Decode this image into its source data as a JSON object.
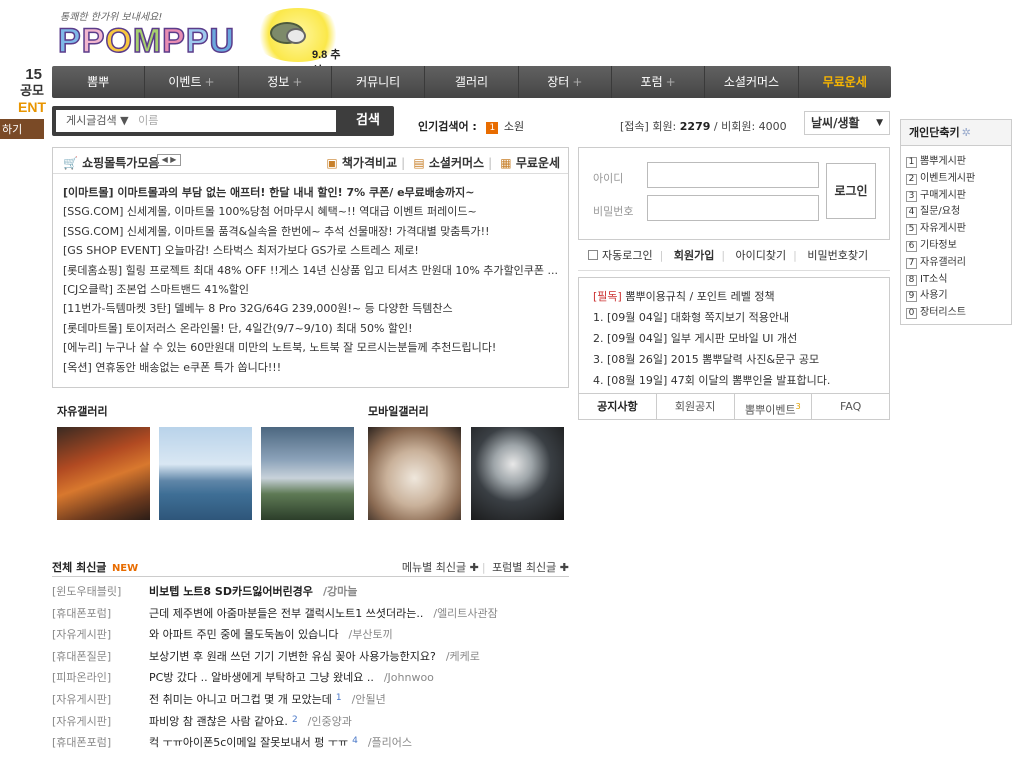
{
  "edge_banner": {
    "year": "15",
    "contest": "공모",
    "event": "ENT",
    "go": "하기"
  },
  "header": {
    "tagline": "통쾌한 한가위 보내세요!",
    "logo": [
      "P",
      "P",
      "O",
      "M",
      "P",
      "P",
      "U"
    ],
    "logo_colors": [
      "#7fb8e8",
      "#f2b7cf",
      "#f8c840",
      "#a7d06f",
      "#e88db3",
      "#9ec9ee",
      "#6aa7de"
    ],
    "holiday_date": "9.8 추석"
  },
  "gnb": {
    "items": [
      {
        "label": "뽐뿌",
        "plus": ""
      },
      {
        "label": "이벤트",
        "plus": "+"
      },
      {
        "label": "정보",
        "plus": "+"
      },
      {
        "label": "커뮤니티",
        "plus": ""
      },
      {
        "label": "갤러리",
        "plus": ""
      },
      {
        "label": "장터",
        "plus": "+"
      },
      {
        "label": "포럼",
        "plus": "+"
      },
      {
        "label": "소셜커머스",
        "plus": ""
      },
      {
        "label": "무료운세",
        "plus": "",
        "highlight": true
      }
    ]
  },
  "search": {
    "select_label": "게시글검색",
    "placeholder": "이름",
    "button": "검색"
  },
  "popular": {
    "label": "인기검색어 :",
    "rank": "1",
    "keyword": "소원"
  },
  "stats": {
    "prefix": "[접속] 회원:",
    "members": "2279",
    "guests_label": "/ 비회원:",
    "guests": "4000"
  },
  "weather": {
    "label": "날씨/생활"
  },
  "shopping": {
    "title": "쇼핑몰특가모음",
    "pager": "◀ ▶",
    "links": [
      "책가격비교",
      "소셜커머스",
      "무료운세"
    ],
    "items": [
      "[이마트몰] 이마트몰과의 부담 없는 애프터! 한달 내내 할인! 7% 쿠폰/ e무료배송까지~",
      "[SSG.COM] 신세계몰, 이마트몰 100%당첨 어마무시 혜택~!! 역대급 이벤트 퍼레이드~",
      "[SSG.COM] 신세계몰, 이마트몰 품격&실속을 한번에~ 추석 선물매장! 가격대별 맞춤특가!!",
      "[GS SHOP EVENT] 오늘마감! 스타벅스 최저가보다 GS가로 스트레스 제로!",
      "[롯데홈쇼핑] 힐링 프로젝트 최대 48% OFF !!게스 14년 신상품 입고 티셔츠 만원대 10% 추가할인쿠폰 ...",
      "[CJ오클락] 조본업 스마트밴드 41%할인",
      "[11번가-득템마켓 3탄] 델베누 8 Pro 32G/64G 239,000원!~ 등 다양한 득템찬스",
      "[롯데마트몰] 토이저러스 온라인몰! 단, 4일간(9/7~9/10) 최대 50% 할인!",
      "[에누리] 누구나 살 수 있는 60만원대 미만의 노트북, 노트북 잘 모르시는분들께 추천드립니다!",
      "[옥션] 연휴동안 배송없는 e쿠폰 특가 쏩니다!!!"
    ]
  },
  "login": {
    "id_label": "아이디",
    "pw_label": "비밀번호",
    "button": "로그인",
    "auto": "자동로그인",
    "join": "회원가입",
    "find_id": "아이디찾기",
    "find_pw": "비밀번호찾기"
  },
  "notice": {
    "required_tag": "[필독]",
    "required_text": "뽐뿌이용규칙 / 포인트 레벨 정책",
    "items": [
      "1. [09월 04일] 대화형 쪽지보기 적용안내",
      "2. [09월 04일] 일부 게시판 모바일 UI 개선",
      "3. [08월 26일] 2015 뽐뿌달력 사진&문구 공모",
      "4. [08월 19일] 47회 이달의 뽐뿌인을 발표합니다."
    ],
    "tabs": [
      {
        "label": "공지사항",
        "badge": ""
      },
      {
        "label": "회원공지",
        "badge": ""
      },
      {
        "label": "뽐뿌이벤트",
        "badge": "3"
      },
      {
        "label": "FAQ",
        "badge": ""
      }
    ]
  },
  "gallery": {
    "free_title": "자유갤러리",
    "mobile_title": "모바일갤러리"
  },
  "latest": {
    "title": "전체 최신글",
    "new_badge": "NEW",
    "right_links": [
      "메뉴별 최신글 ✚",
      "포럼별 최신글 ✚"
    ],
    "rows": [
      {
        "cat": "[윈도우태블릿]",
        "subject": "비보텝 노트8 SD카드잃어버린경우",
        "comments": "",
        "user": "/강마늘"
      },
      {
        "cat": "[휴대폰포럼]",
        "subject": "근데 제주변에 아줌마분들은 전부 갤럭시노트1 쓰셧더라는..",
        "comments": "",
        "user": "/엘리트사관잠"
      },
      {
        "cat": "[자유게시판]",
        "subject": "와 아파트 주민 중에 몰도둑놈이 있습니다",
        "comments": "",
        "user": "/부산토끼"
      },
      {
        "cat": "[휴대폰질문]",
        "subject": "보상기변 후 원래 쓰던 기기 기변한 유심 꽂아 사용가능한지요?",
        "comments": "",
        "user": "/케케로"
      },
      {
        "cat": "[피파온라인]",
        "subject": "PC방 갔다 .. 알바생에게 부탁하고 그냥 왔네요 ..",
        "comments": "",
        "user": "/Johnwoo"
      },
      {
        "cat": "[자유게시판]",
        "subject": "전 취미는 아니고 머그컵 몇 개 모았는데",
        "comments": "1",
        "user": "/안될년"
      },
      {
        "cat": "[자유게시판]",
        "subject": "파비앙 참 괜찮은 사람 같아요.",
        "comments": "2",
        "user": "/인중양과"
      },
      {
        "cat": "[휴대폰포럼]",
        "subject": "컥 ㅜㅠ아이폰5c이메일 잘못보내서 펑 ㅜㅠ",
        "comments": "4",
        "user": "/플리어스"
      }
    ]
  },
  "quick": {
    "title": "개인단축키",
    "items": [
      {
        "key": "1",
        "label": "뽐뿌게시판"
      },
      {
        "key": "2",
        "label": "이벤트게시판"
      },
      {
        "key": "3",
        "label": "구매게시판"
      },
      {
        "key": "4",
        "label": "질문/요청"
      },
      {
        "key": "5",
        "label": "자유게시판"
      },
      {
        "key": "6",
        "label": "기타정보"
      },
      {
        "key": "7",
        "label": "자유갤러리"
      },
      {
        "key": "8",
        "label": "IT소식"
      },
      {
        "key": "9",
        "label": "사용기"
      },
      {
        "key": "0",
        "label": "장터리스트"
      }
    ]
  }
}
